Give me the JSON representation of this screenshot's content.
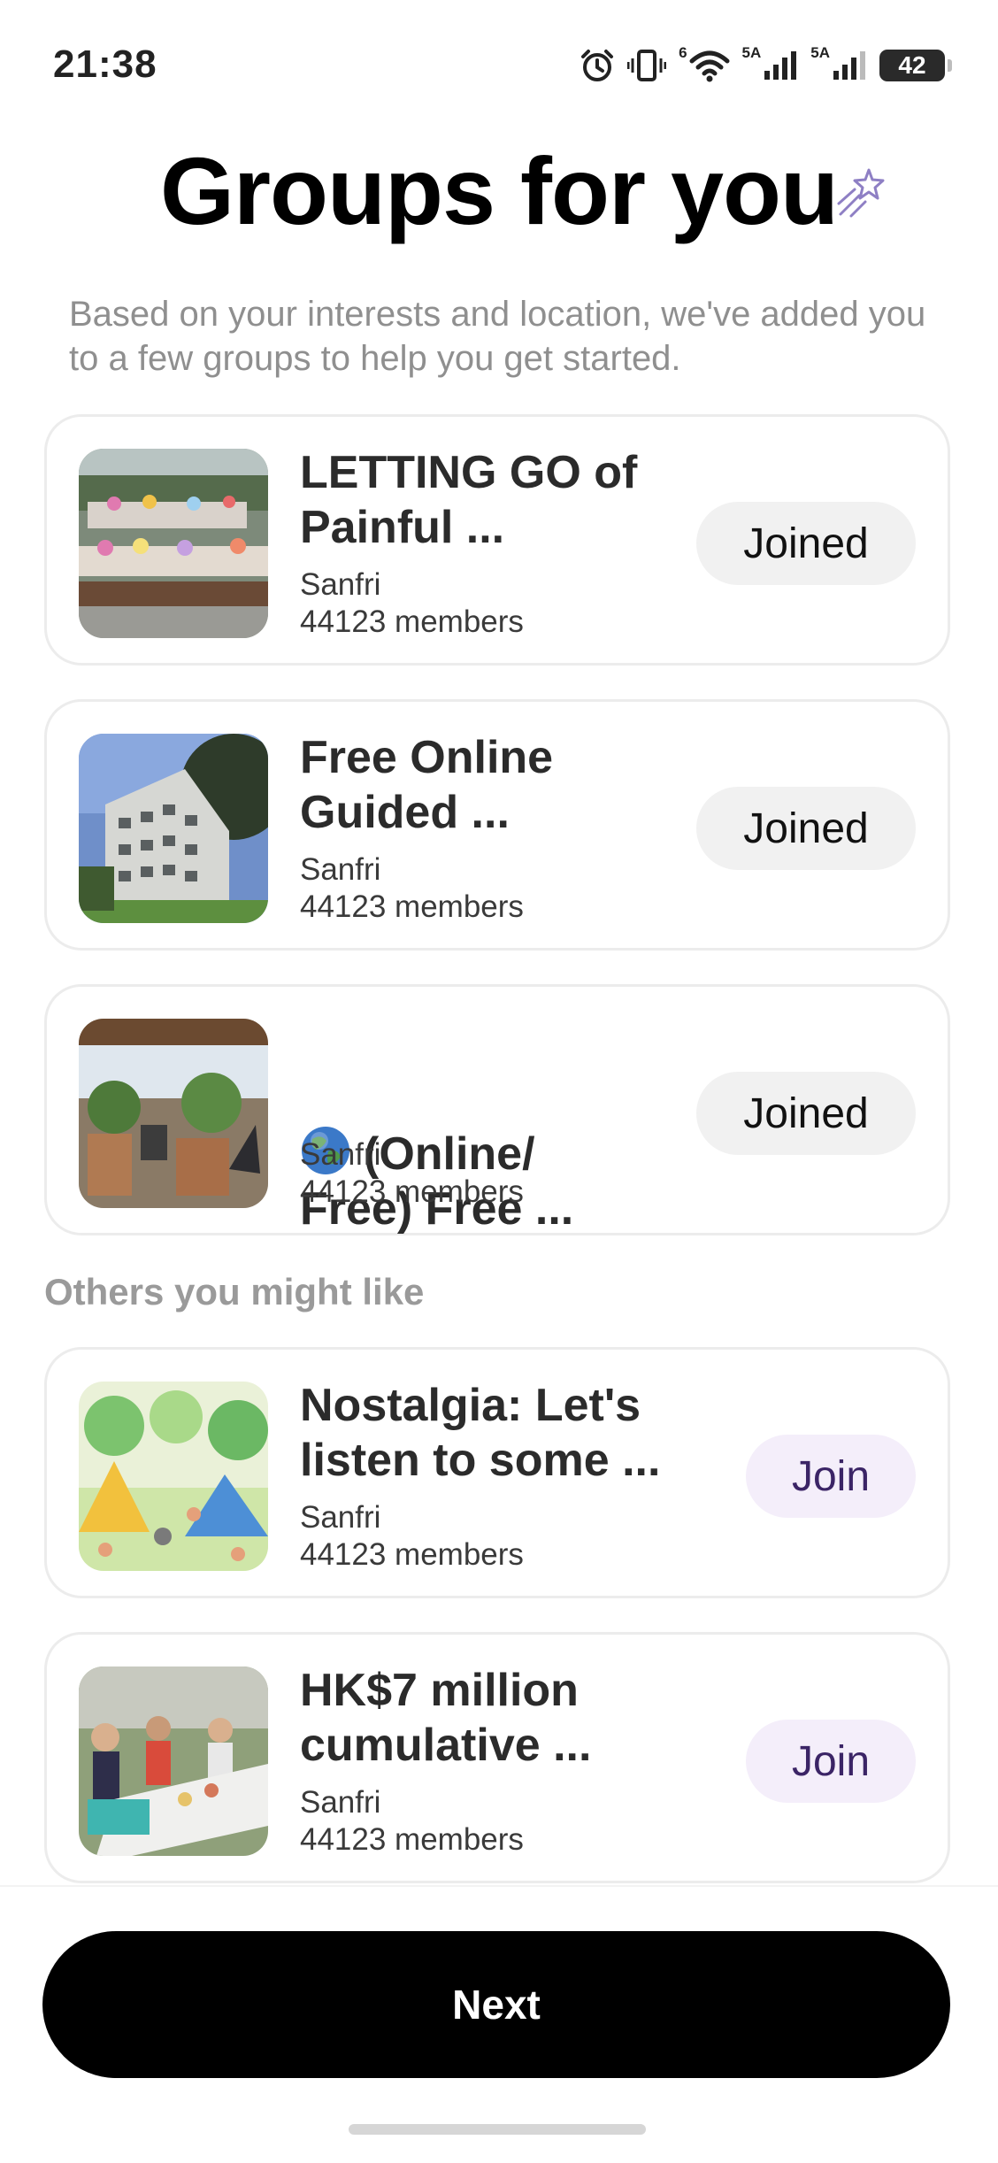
{
  "status_bar": {
    "time": "21:38",
    "network_label_1": "6",
    "network_label_2": "5A",
    "network_label_3": "5A",
    "battery": "42",
    "icons": [
      "alarm-icon",
      "vibrate-icon",
      "wifi-icon",
      "signal-icon",
      "signal-icon",
      "battery-icon"
    ]
  },
  "header": {
    "title": "Groups for you",
    "title_icon": "shooting-star-icon",
    "subtitle": "Based on your interests and location, we've added you to a few groups to help you get started."
  },
  "joined_groups": [
    {
      "name": "LETTING GO of\nPainful ...",
      "location": "Sanfri",
      "members": "44123 members",
      "button": "Joined",
      "thumb": "garden-tables-photo"
    },
    {
      "name": "Free Online\nGuided ...",
      "location": "Sanfri",
      "members": "44123 members",
      "button": "Joined",
      "thumb": "apartment-building-photo"
    },
    {
      "name_prefix_icon": "globe-emoji",
      "name": "(Online/\nFree) Free ...",
      "location": "Sanfri",
      "members": "44123 members",
      "button": "Joined",
      "thumb": "outdoor-cafe-photo"
    }
  ],
  "others": {
    "heading": "Others you might like",
    "groups": [
      {
        "name": "Nostalgia: Let's\nlisten to some ...",
        "location": "Sanfri",
        "members": "44123 members",
        "button": "Join",
        "thumb": "camping-illustration"
      },
      {
        "name": "HK$7 million\ncumulative ...",
        "location": "Sanfri",
        "members": "44123 members",
        "button": "Join",
        "thumb": "street-party-photo"
      }
    ]
  },
  "footer": {
    "next_label": "Next"
  },
  "colors": {
    "primary_button": "#000000",
    "join_button_bg": "#f4eefa",
    "join_button_text": "#3b2466",
    "joined_button_bg": "#f1f1f1",
    "subtitle_text": "#8f8f8f",
    "card_border": "#ececec"
  }
}
